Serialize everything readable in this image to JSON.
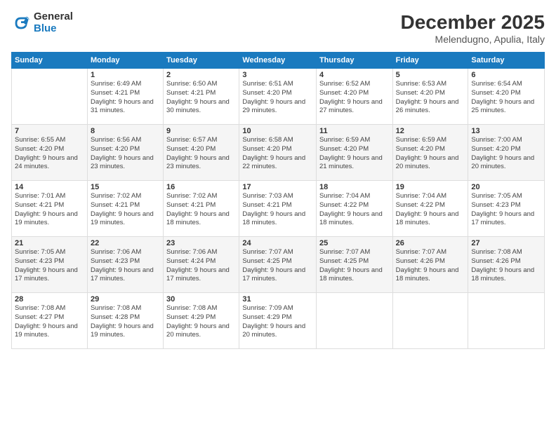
{
  "logo": {
    "general": "General",
    "blue": "Blue"
  },
  "header": {
    "month": "December 2025",
    "location": "Melendugno, Apulia, Italy"
  },
  "weekdays": [
    "Sunday",
    "Monday",
    "Tuesday",
    "Wednesday",
    "Thursday",
    "Friday",
    "Saturday"
  ],
  "weeks": [
    [
      {
        "day": "",
        "sunrise": "",
        "sunset": "",
        "daylight": ""
      },
      {
        "day": "1",
        "sunrise": "Sunrise: 6:49 AM",
        "sunset": "Sunset: 4:21 PM",
        "daylight": "Daylight: 9 hours and 31 minutes."
      },
      {
        "day": "2",
        "sunrise": "Sunrise: 6:50 AM",
        "sunset": "Sunset: 4:21 PM",
        "daylight": "Daylight: 9 hours and 30 minutes."
      },
      {
        "day": "3",
        "sunrise": "Sunrise: 6:51 AM",
        "sunset": "Sunset: 4:20 PM",
        "daylight": "Daylight: 9 hours and 29 minutes."
      },
      {
        "day": "4",
        "sunrise": "Sunrise: 6:52 AM",
        "sunset": "Sunset: 4:20 PM",
        "daylight": "Daylight: 9 hours and 27 minutes."
      },
      {
        "day": "5",
        "sunrise": "Sunrise: 6:53 AM",
        "sunset": "Sunset: 4:20 PM",
        "daylight": "Daylight: 9 hours and 26 minutes."
      },
      {
        "day": "6",
        "sunrise": "Sunrise: 6:54 AM",
        "sunset": "Sunset: 4:20 PM",
        "daylight": "Daylight: 9 hours and 25 minutes."
      }
    ],
    [
      {
        "day": "7",
        "sunrise": "Sunrise: 6:55 AM",
        "sunset": "Sunset: 4:20 PM",
        "daylight": "Daylight: 9 hours and 24 minutes."
      },
      {
        "day": "8",
        "sunrise": "Sunrise: 6:56 AM",
        "sunset": "Sunset: 4:20 PM",
        "daylight": "Daylight: 9 hours and 23 minutes."
      },
      {
        "day": "9",
        "sunrise": "Sunrise: 6:57 AM",
        "sunset": "Sunset: 4:20 PM",
        "daylight": "Daylight: 9 hours and 23 minutes."
      },
      {
        "day": "10",
        "sunrise": "Sunrise: 6:58 AM",
        "sunset": "Sunset: 4:20 PM",
        "daylight": "Daylight: 9 hours and 22 minutes."
      },
      {
        "day": "11",
        "sunrise": "Sunrise: 6:59 AM",
        "sunset": "Sunset: 4:20 PM",
        "daylight": "Daylight: 9 hours and 21 minutes."
      },
      {
        "day": "12",
        "sunrise": "Sunrise: 6:59 AM",
        "sunset": "Sunset: 4:20 PM",
        "daylight": "Daylight: 9 hours and 20 minutes."
      },
      {
        "day": "13",
        "sunrise": "Sunrise: 7:00 AM",
        "sunset": "Sunset: 4:20 PM",
        "daylight": "Daylight: 9 hours and 20 minutes."
      }
    ],
    [
      {
        "day": "14",
        "sunrise": "Sunrise: 7:01 AM",
        "sunset": "Sunset: 4:21 PM",
        "daylight": "Daylight: 9 hours and 19 minutes."
      },
      {
        "day": "15",
        "sunrise": "Sunrise: 7:02 AM",
        "sunset": "Sunset: 4:21 PM",
        "daylight": "Daylight: 9 hours and 19 minutes."
      },
      {
        "day": "16",
        "sunrise": "Sunrise: 7:02 AM",
        "sunset": "Sunset: 4:21 PM",
        "daylight": "Daylight: 9 hours and 18 minutes."
      },
      {
        "day": "17",
        "sunrise": "Sunrise: 7:03 AM",
        "sunset": "Sunset: 4:21 PM",
        "daylight": "Daylight: 9 hours and 18 minutes."
      },
      {
        "day": "18",
        "sunrise": "Sunrise: 7:04 AM",
        "sunset": "Sunset: 4:22 PM",
        "daylight": "Daylight: 9 hours and 18 minutes."
      },
      {
        "day": "19",
        "sunrise": "Sunrise: 7:04 AM",
        "sunset": "Sunset: 4:22 PM",
        "daylight": "Daylight: 9 hours and 18 minutes."
      },
      {
        "day": "20",
        "sunrise": "Sunrise: 7:05 AM",
        "sunset": "Sunset: 4:23 PM",
        "daylight": "Daylight: 9 hours and 17 minutes."
      }
    ],
    [
      {
        "day": "21",
        "sunrise": "Sunrise: 7:05 AM",
        "sunset": "Sunset: 4:23 PM",
        "daylight": "Daylight: 9 hours and 17 minutes."
      },
      {
        "day": "22",
        "sunrise": "Sunrise: 7:06 AM",
        "sunset": "Sunset: 4:23 PM",
        "daylight": "Daylight: 9 hours and 17 minutes."
      },
      {
        "day": "23",
        "sunrise": "Sunrise: 7:06 AM",
        "sunset": "Sunset: 4:24 PM",
        "daylight": "Daylight: 9 hours and 17 minutes."
      },
      {
        "day": "24",
        "sunrise": "Sunrise: 7:07 AM",
        "sunset": "Sunset: 4:25 PM",
        "daylight": "Daylight: 9 hours and 17 minutes."
      },
      {
        "day": "25",
        "sunrise": "Sunrise: 7:07 AM",
        "sunset": "Sunset: 4:25 PM",
        "daylight": "Daylight: 9 hours and 18 minutes."
      },
      {
        "day": "26",
        "sunrise": "Sunrise: 7:07 AM",
        "sunset": "Sunset: 4:26 PM",
        "daylight": "Daylight: 9 hours and 18 minutes."
      },
      {
        "day": "27",
        "sunrise": "Sunrise: 7:08 AM",
        "sunset": "Sunset: 4:26 PM",
        "daylight": "Daylight: 9 hours and 18 minutes."
      }
    ],
    [
      {
        "day": "28",
        "sunrise": "Sunrise: 7:08 AM",
        "sunset": "Sunset: 4:27 PM",
        "daylight": "Daylight: 9 hours and 19 minutes."
      },
      {
        "day": "29",
        "sunrise": "Sunrise: 7:08 AM",
        "sunset": "Sunset: 4:28 PM",
        "daylight": "Daylight: 9 hours and 19 minutes."
      },
      {
        "day": "30",
        "sunrise": "Sunrise: 7:08 AM",
        "sunset": "Sunset: 4:29 PM",
        "daylight": "Daylight: 9 hours and 20 minutes."
      },
      {
        "day": "31",
        "sunrise": "Sunrise: 7:09 AM",
        "sunset": "Sunset: 4:29 PM",
        "daylight": "Daylight: 9 hours and 20 minutes."
      },
      {
        "day": "",
        "sunrise": "",
        "sunset": "",
        "daylight": ""
      },
      {
        "day": "",
        "sunrise": "",
        "sunset": "",
        "daylight": ""
      },
      {
        "day": "",
        "sunrise": "",
        "sunset": "",
        "daylight": ""
      }
    ]
  ]
}
